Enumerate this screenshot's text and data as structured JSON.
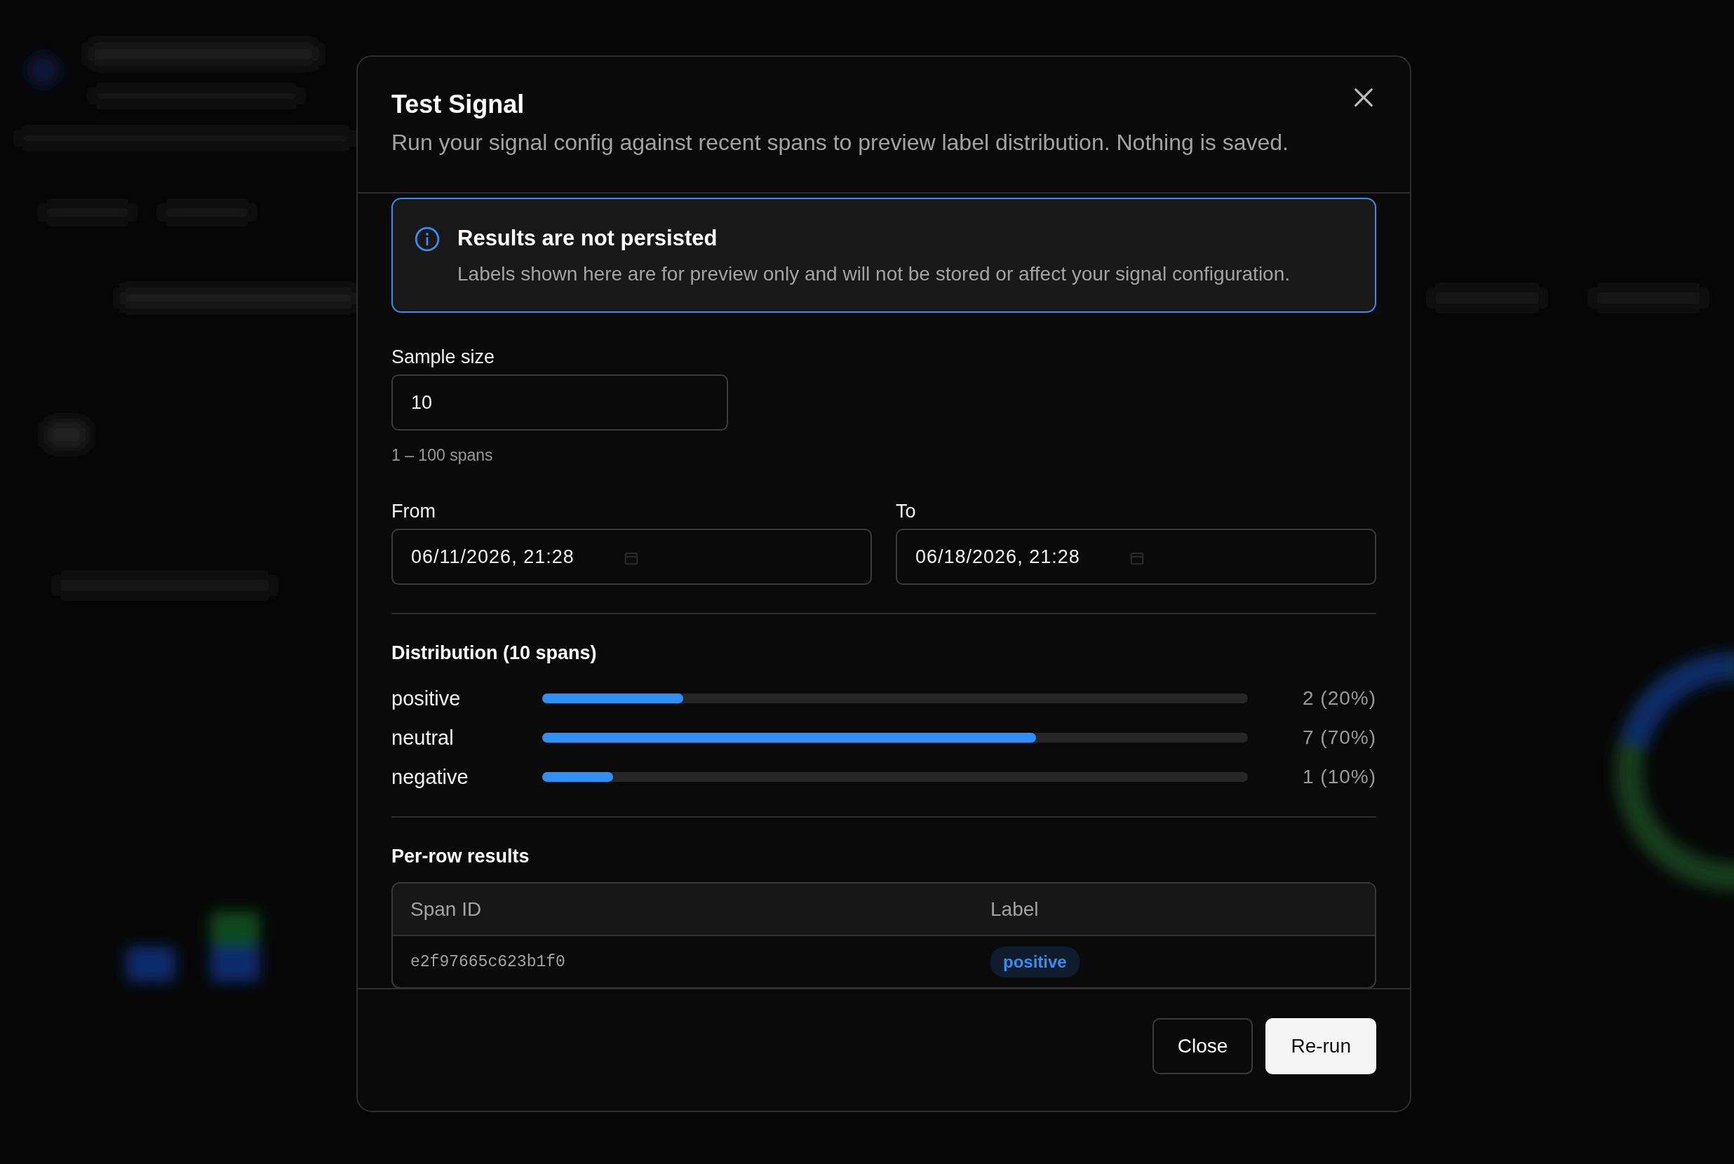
{
  "dialog": {
    "title": "Test Signal",
    "description": "Run your signal config against recent spans to preview label distribution. Nothing is saved.",
    "notice": {
      "title": "Results are not persisted",
      "text": "Labels shown here are for preview only and will not be stored or affect your signal configuration."
    },
    "sample_size": {
      "label": "Sample size",
      "value": "10",
      "helper": "1 – 100 spans"
    },
    "date_range": [
      {
        "label": "From",
        "value": "06/11/2026, 21:28"
      },
      {
        "label": "To",
        "value": "06/18/2026, 21:28"
      }
    ],
    "distribution": {
      "title": "Distribution (10 spans)",
      "rows": [
        {
          "label": "positive",
          "level": 0.2,
          "reading": "2 (20%)"
        },
        {
          "label": "neutral",
          "level": 0.7,
          "reading": "7 (70%)"
        },
        {
          "label": "negative",
          "level": 0.1,
          "reading": "1 (10%)"
        }
      ]
    },
    "per_row": {
      "title": "Per-row results",
      "columns": [
        "Span ID",
        "Label"
      ],
      "rows": [
        {
          "span_id": "e2f97665c623b1f0",
          "label": "positive"
        }
      ]
    },
    "buttons": [
      {
        "label": "Close",
        "kind": "secondary"
      },
      {
        "label": "Re-run",
        "kind": "primary"
      }
    ]
  }
}
